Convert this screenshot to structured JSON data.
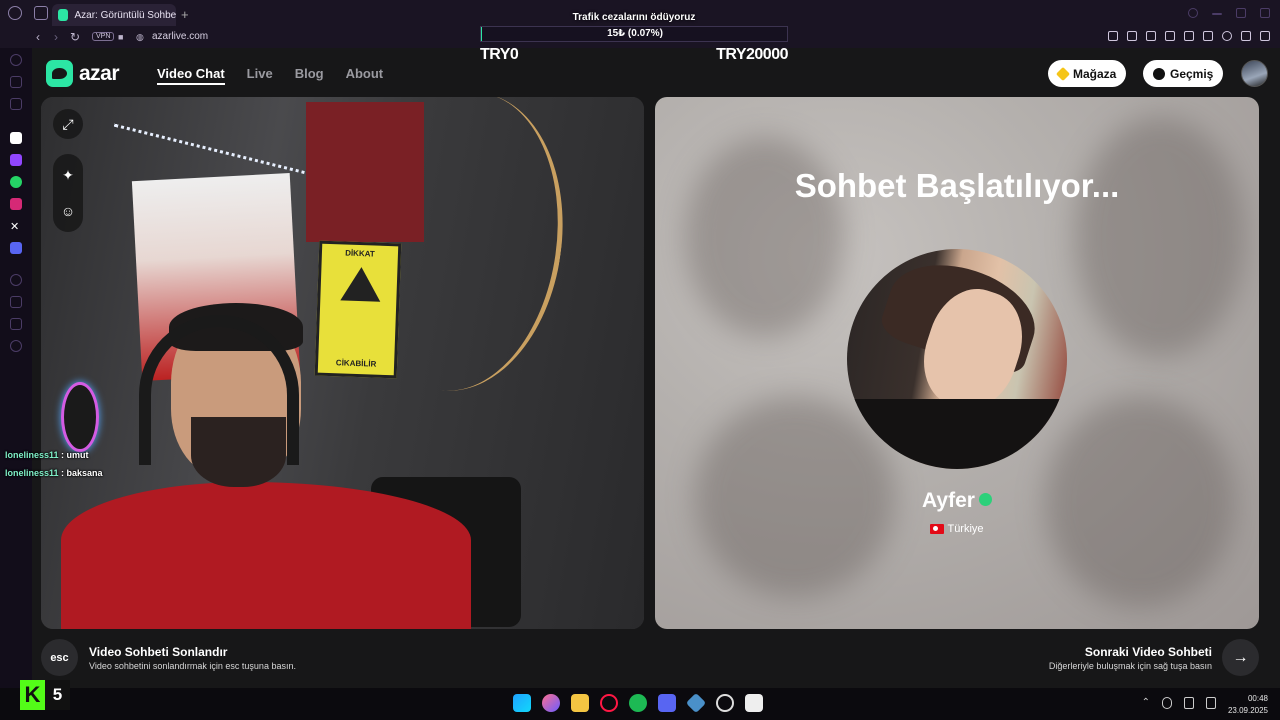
{
  "browser": {
    "tab_title": "Azar: Görüntülü Sohbet, A",
    "url": "azarlive.com",
    "vpn_label": "VPN"
  },
  "donation": {
    "title": "Trafik cezalarını ödüyoruz",
    "value_text": "15₺ (0.07%)",
    "progress_percent": 0.07,
    "min_label": "TRY0",
    "max_label": "TRY20000"
  },
  "header": {
    "brand": "azar",
    "nav": [
      "Video Chat",
      "Live",
      "Blog",
      "About"
    ],
    "active_nav": "Video Chat",
    "shop_label": "Mağaza",
    "history_label": "Geçmiş"
  },
  "match": {
    "status_title": "Sohbet Başlatılıyor...",
    "name": "Ayfer",
    "country": "Türkiye"
  },
  "controls": {
    "esc_key": "esc",
    "end_title": "Video Sohbeti Sonlandır",
    "end_sub": "Video sohbetini sonlandırmak için esc tuşuna basın.",
    "next_title": "Sonraki Video Sohbeti",
    "next_sub": "Diğerleriyle buluşmak için sağ tuşa basın",
    "next_arrow": "→"
  },
  "chat": [
    {
      "user": "loneliness11",
      "message": "umut"
    },
    {
      "user": "loneliness11",
      "message": "baksana"
    }
  ],
  "poster_texts": {
    "sign_label": "DİKKAT",
    "sign_caption": "CİKABİLİR"
  },
  "overlay": {
    "kick_letter": "K",
    "kick_count": "5"
  },
  "taskbar": {
    "time": "00:48",
    "date": "23.09.2025"
  },
  "colors": {
    "accent": "#2ce6a4",
    "verified": "#2cd07a",
    "kick_green": "#53fc18"
  }
}
